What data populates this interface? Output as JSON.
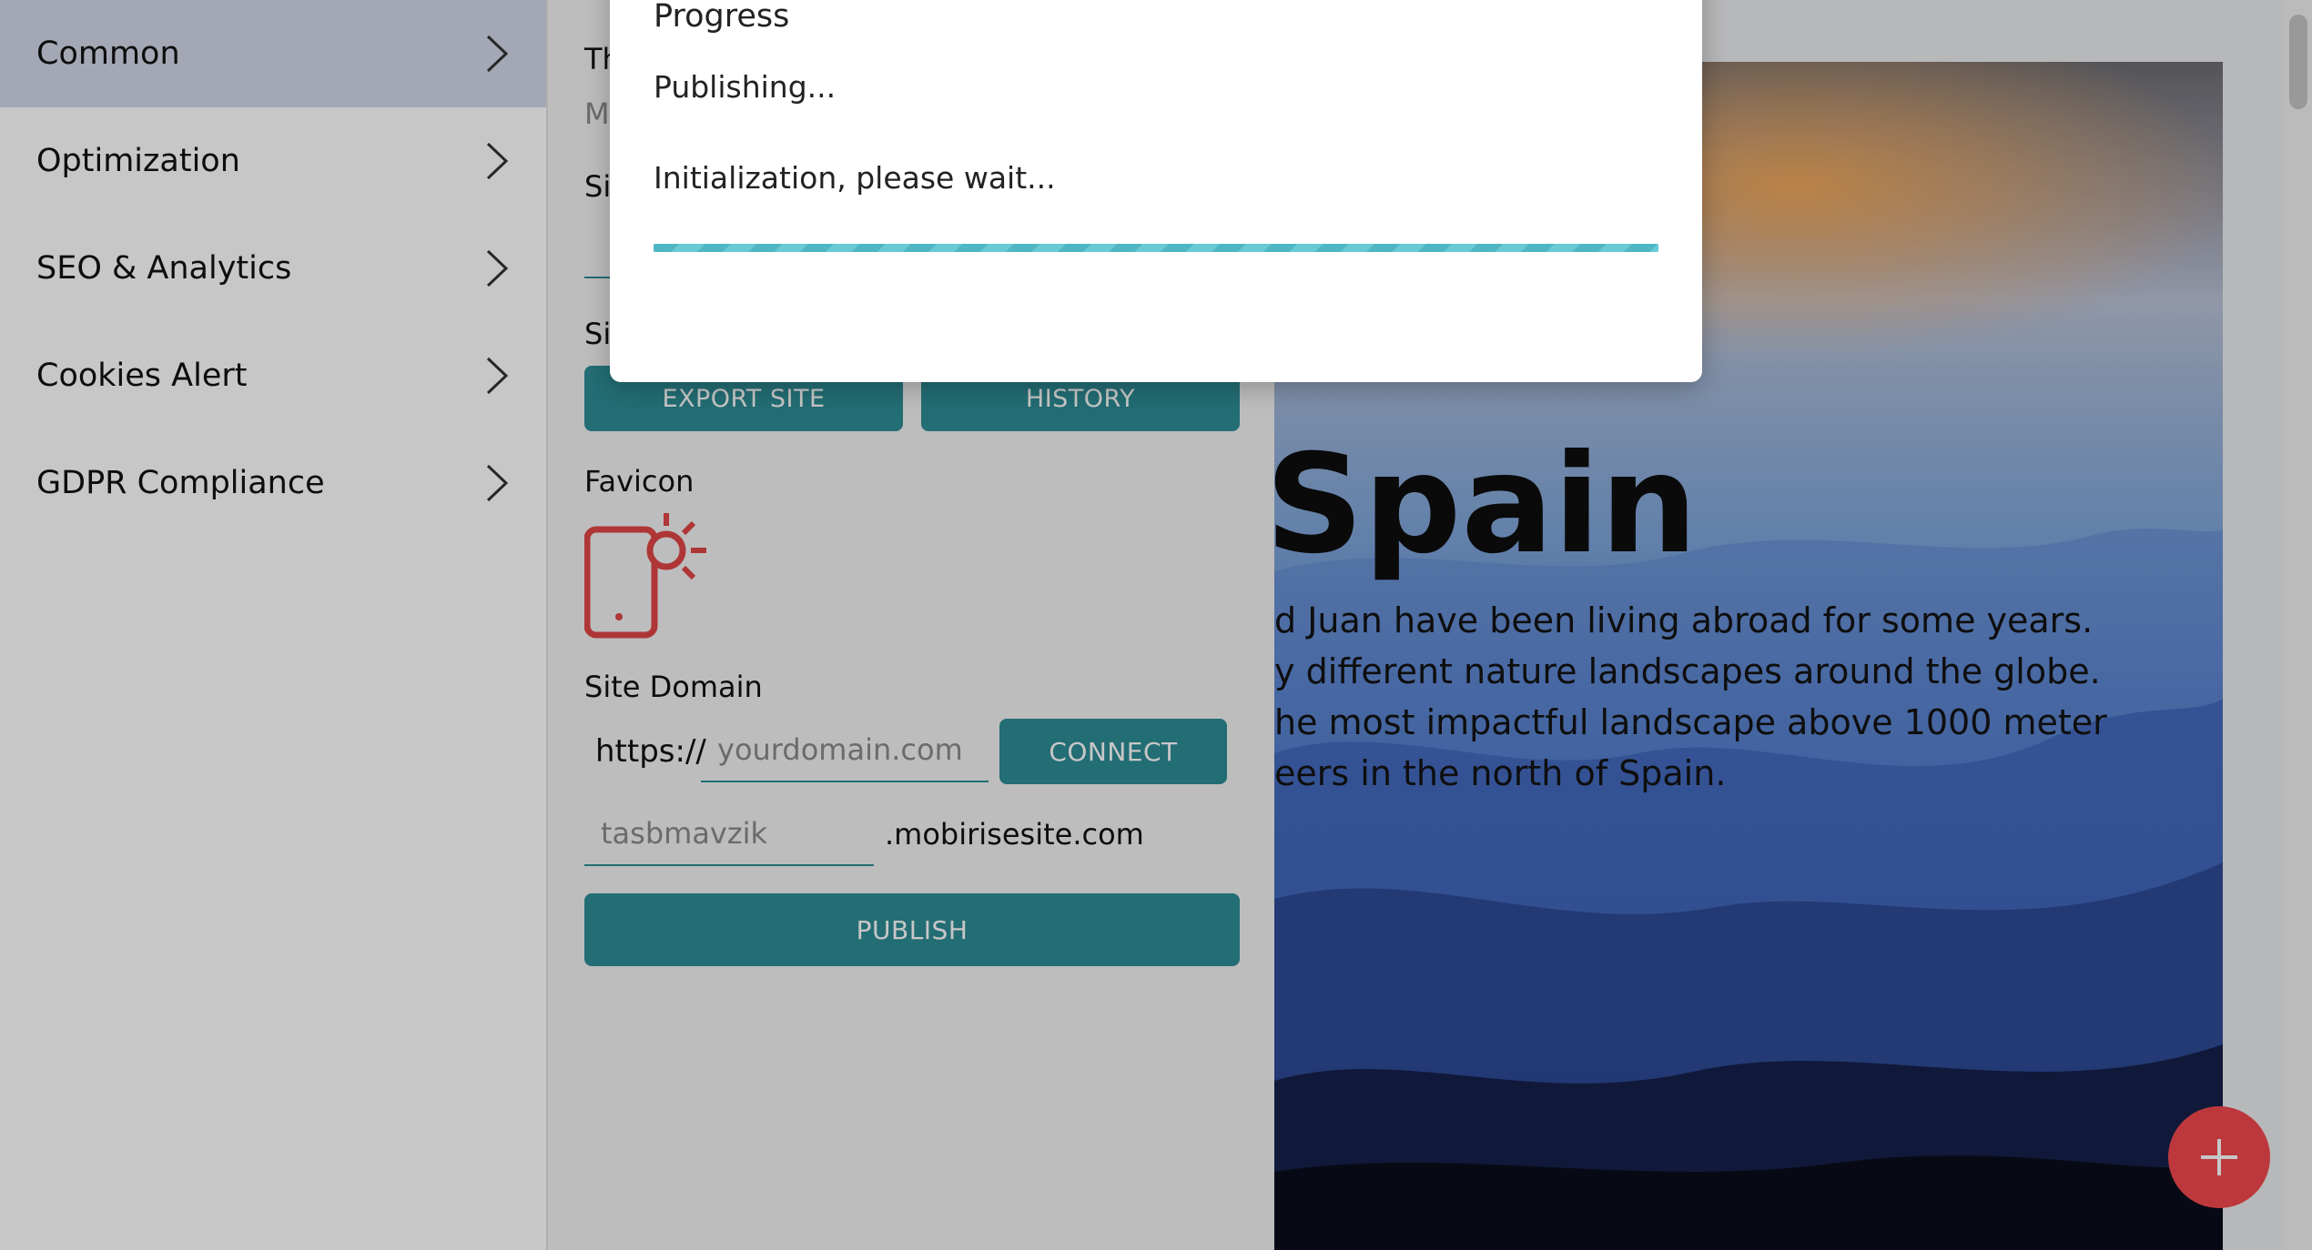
{
  "sidebar": {
    "items": [
      {
        "label": "Common"
      },
      {
        "label": "Optimization"
      },
      {
        "label": "SEO & Analytics"
      },
      {
        "label": "Cookies Alert"
      },
      {
        "label": "GDPR Compliance"
      }
    ]
  },
  "panel": {
    "partial_labels": [
      "Th",
      "M",
      "Sit",
      "Sit"
    ],
    "buttons": {
      "export": "EXPORT SITE",
      "history": "HISTORY",
      "connect": "CONNECT",
      "publish": "PUBLISH"
    },
    "favicon_label": "Favicon",
    "site_domain_label": "Site Domain",
    "protocol": "https://",
    "domain_placeholder": "yourdomain.com",
    "subdomain_value": "tasbmavzik",
    "subdomain_suffix": ".mobirisesite.com"
  },
  "preview": {
    "title": "Spain",
    "text_lines": [
      "d Juan have been living abroad for some years.",
      "y different nature landscapes around the globe.",
      "he most impactful landscape above 1000 meter",
      "eers in the north of Spain."
    ]
  },
  "dialog": {
    "title": "Progress",
    "status": "Publishing...",
    "message": "Initialization, please wait..."
  },
  "colors": {
    "accent": "#2e8c95",
    "progress": "#5bbfcb",
    "fab": "#f2484d",
    "favicon": "#e04646",
    "menu_active": "#d2d8e8"
  },
  "icons": [
    "chevron-right-icon",
    "phone-sun-icon",
    "plus-icon"
  ]
}
